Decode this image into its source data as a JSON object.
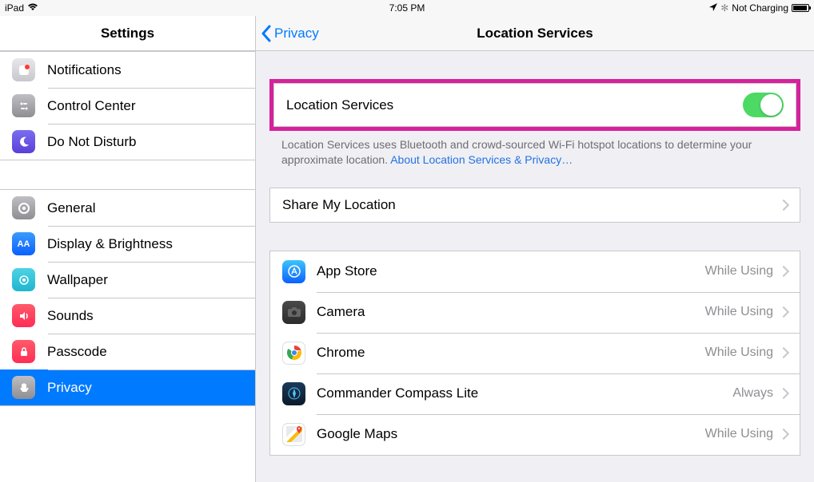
{
  "status": {
    "device": "iPad",
    "time": "7:05 PM",
    "charging": "Not Charging"
  },
  "sidebar": {
    "title": "Settings",
    "group1": [
      {
        "label": "Notifications"
      },
      {
        "label": "Control Center"
      },
      {
        "label": "Do Not Disturb"
      }
    ],
    "group2": [
      {
        "label": "General"
      },
      {
        "label": "Display & Brightness"
      },
      {
        "label": "Wallpaper"
      },
      {
        "label": "Sounds"
      },
      {
        "label": "Passcode"
      },
      {
        "label": "Privacy"
      }
    ]
  },
  "detail": {
    "back": "Privacy",
    "title": "Location Services",
    "main_toggle_label": "Location Services",
    "footer_text": "Location Services uses Bluetooth and crowd-sourced Wi-Fi hotspot locations to determine your approximate location. ",
    "footer_link": "About Location Services & Privacy…",
    "share_label": "Share My Location",
    "apps": [
      {
        "name": "App Store",
        "status": "While Using"
      },
      {
        "name": "Camera",
        "status": "While Using"
      },
      {
        "name": "Chrome",
        "status": "While Using"
      },
      {
        "name": "Commander Compass Lite",
        "status": "Always"
      },
      {
        "name": "Google Maps",
        "status": "While Using"
      }
    ]
  }
}
